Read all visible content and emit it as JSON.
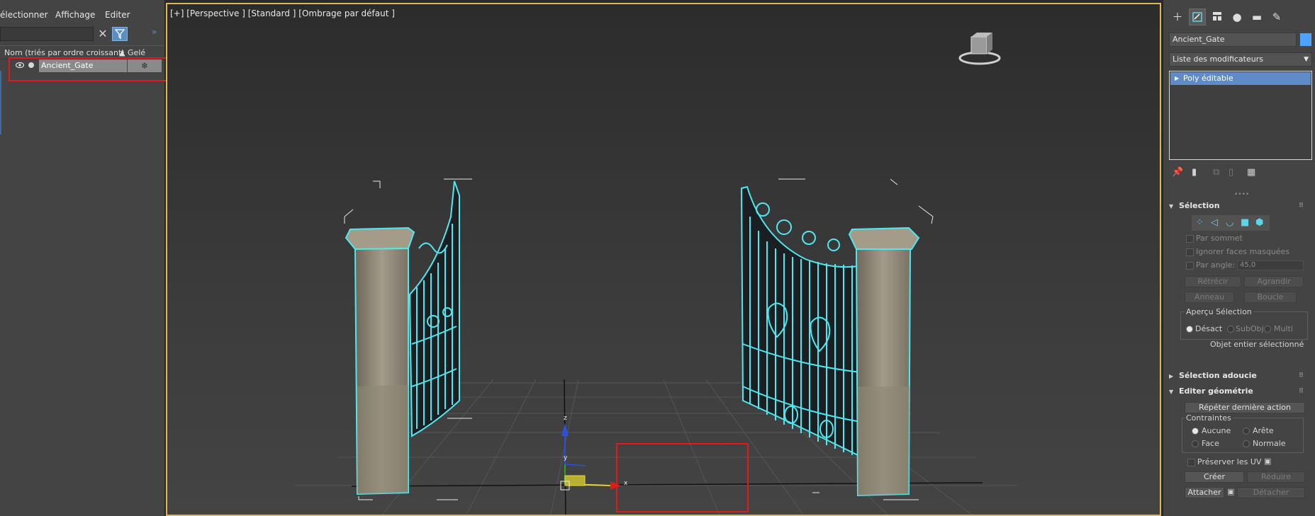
{
  "scene_explorer": {
    "menu": [
      "électionner",
      "Affichage",
      "Editer"
    ],
    "search_value": "",
    "columns": {
      "name": "Nom (triés par ordre croissant)",
      "frozen": "▲ Gelé"
    },
    "rows": [
      {
        "label": "Ancient_Gate",
        "freeze_glyph": "❄"
      }
    ]
  },
  "viewport": {
    "label": "[+] [Perspective ] [Standard ] [Ombrage par défaut ]",
    "axes": {
      "x": "x",
      "y": "y",
      "z": "z"
    },
    "colors": {
      "selection": "#4fe8f0",
      "highlight_box": "#e01b1b",
      "active_border": "#e0b84f",
      "x_axis": "#e01b1b",
      "y_axis": "#2ba02b",
      "z_axis": "#2d4fe0"
    }
  },
  "command_panel": {
    "tabs": [
      "create-icon",
      "modify-icon",
      "hierarchy-icon",
      "motion-icon",
      "display-icon",
      "utilities-icon"
    ],
    "object_name": "Ancient_Gate",
    "object_color": "#4ea3ff",
    "modifier_list": "Liste des modificateurs",
    "stack": [
      {
        "label": "Poly éditable"
      }
    ],
    "selection": {
      "title": "Sélection",
      "by_vertex": "Par sommet",
      "ignore_backfaces": "Ignorer faces masquées",
      "by_angle": "Par angle:",
      "angle_value": "45,0",
      "shrink": "Rétrécir",
      "grow": "Agrandir",
      "ring": "Anneau",
      "loop": "Boucle",
      "preview_title": "Aperçu Sélection",
      "preview_off": "Désact",
      "preview_subobj": "SubObj",
      "preview_multi": "Multi",
      "status": "Objet entier sélectionné"
    },
    "soft_selection": {
      "title": "Sélection adoucie"
    },
    "edit_geometry": {
      "title": "Editer géométrie",
      "repeat_last": "Répéter dernière action",
      "constraints_title": "Contraintes",
      "none": "Aucune",
      "edge": "Arête",
      "face": "Face",
      "normal": "Normale",
      "preserve_uv": "Préserver les UV",
      "create": "Créer",
      "collapse": "Réduire",
      "attach": "Attacher",
      "detach": "Détacher"
    }
  }
}
